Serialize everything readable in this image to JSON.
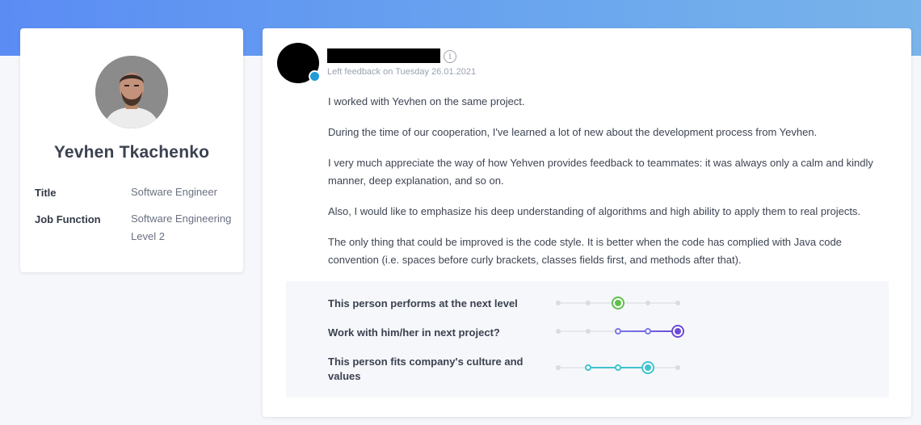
{
  "colors": {
    "header_gradient_start": "#5b8cf4",
    "header_gradient_end": "#79b3ea",
    "rating_green": "#5fbe4a",
    "rating_purple": "#6a4bd6",
    "rating_purple_light": "#7b78e6",
    "rating_teal": "#3fc3cf",
    "reviewer_badge": "#1f9bd6"
  },
  "profile": {
    "name": "Yevhen Tkachenko",
    "avatar_icon": "person-photo",
    "fields": [
      {
        "label": "Title",
        "value": "Software Engineer"
      },
      {
        "label": "Job Function",
        "value": "Software Engineering Level 2"
      }
    ]
  },
  "feedback": {
    "reviewer_avatar": "redacted-avatar",
    "reviewer_name_redacted": true,
    "info_icon": "info-icon",
    "info_glyph": "i",
    "date_text": "Left feedback on Tuesday 26.01.2021",
    "paragraphs": [
      "I worked with Yevhen on the same project.",
      "During the time of our cooperation, I've learned a lot of new about the development process from Yevhen.",
      "I very much appreciate the way of how Yehven provides feedback to teammates: it was always only a calm and kindly manner, deep explanation, and so on.",
      "Also, I would like to emphasize his deep understanding of algorithms and high ability to apply them to real projects.",
      "The only thing that could be improved is the code style. It is better when the code has complied with Java code convention (i.e. spaces before curly brackets, classes fields first, and methods after that)."
    ]
  },
  "ratings": [
    {
      "label": "This person performs at the next level",
      "selected": 3,
      "of": 5,
      "color": "#5fbe4a"
    },
    {
      "label": "Work with him/her in next project?",
      "selected": 5,
      "of": 5,
      "color": "#6a4bd6"
    },
    {
      "label": "This person fits company's culture and values",
      "selected": 4,
      "of": 5,
      "color": "#3fc3cf"
    }
  ]
}
